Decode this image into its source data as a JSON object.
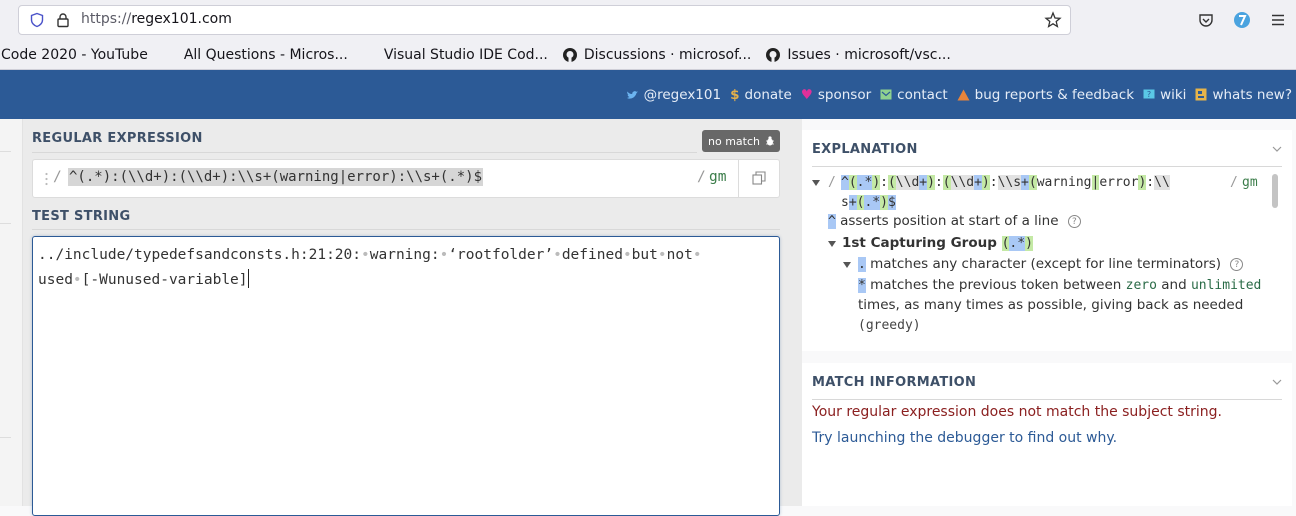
{
  "browser": {
    "url_scheme": "https://",
    "url_host": "regex101.com",
    "bookmarks": [
      {
        "label": "Code 2020 - YouTube",
        "icon": "none"
      },
      {
        "label": "All Questions - Micros...",
        "icon": "microsoft-logo"
      },
      {
        "label": "Visual Studio IDE Cod...",
        "icon": "microsoft-logo"
      },
      {
        "label": "Discussions · microsof...",
        "icon": "github-icon"
      },
      {
        "label": "Issues · microsoft/vsc...",
        "icon": "github-icon"
      }
    ]
  },
  "header": {
    "nav": [
      {
        "label": "@regex101",
        "icon": "twitter-icon",
        "color": "#6cb4f0"
      },
      {
        "label": "donate",
        "icon": "dollar-icon",
        "color": "#e3b04b"
      },
      {
        "label": "sponsor",
        "icon": "heart-icon",
        "color": "#e0309a"
      },
      {
        "label": "contact",
        "icon": "mail-icon",
        "color": "#8fd18f"
      },
      {
        "label": "bug reports & feedback",
        "icon": "warning-icon",
        "color": "#e8843b"
      },
      {
        "label": "wiki",
        "icon": "help-box-icon",
        "color": "#5ac8e6"
      },
      {
        "label": "whats new?",
        "icon": "news-icon",
        "color": "#e6b44a"
      }
    ]
  },
  "regex_section": {
    "label": "REGULAR EXPRESSION",
    "status_badge": "no match",
    "open_delimiter": "/",
    "pattern": "^(.*):(\\\\d+):(\\\\d+):\\\\s+(warning|error):\\\\s+(.*)$",
    "close_delimiter": "/",
    "flags": "gm"
  },
  "test_section": {
    "label": "TEST STRING",
    "line1_parts": [
      "../include/typedefsandconsts.h:21:20:",
      "warning:",
      "‘rootfolder’",
      "defined",
      "but",
      "not"
    ],
    "line2_parts": [
      "used",
      "[-Wunused-variable]"
    ]
  },
  "explanation": {
    "title": "EXPLANATION",
    "delimiter": "/",
    "flags": "gm",
    "items": [
      {
        "token": "^",
        "text": "asserts position at start of a line"
      },
      {
        "heading": "1st Capturing Group",
        "token": "(.*)"
      },
      {
        "token": ".",
        "text": "matches any character (except for line terminators)"
      },
      {
        "token": "*",
        "text_before": "matches the previous token between",
        "kw1": "zero",
        "mid": "and",
        "kw2": "unlimited",
        "line2": "times, as many times as possible, giving back as needed",
        "line3": "(greedy)"
      }
    ]
  },
  "match_info": {
    "title": "MATCH INFORMATION",
    "error": "Your regular expression does not match the subject string.",
    "debugger_link": "Try launching the debugger to find out why."
  }
}
